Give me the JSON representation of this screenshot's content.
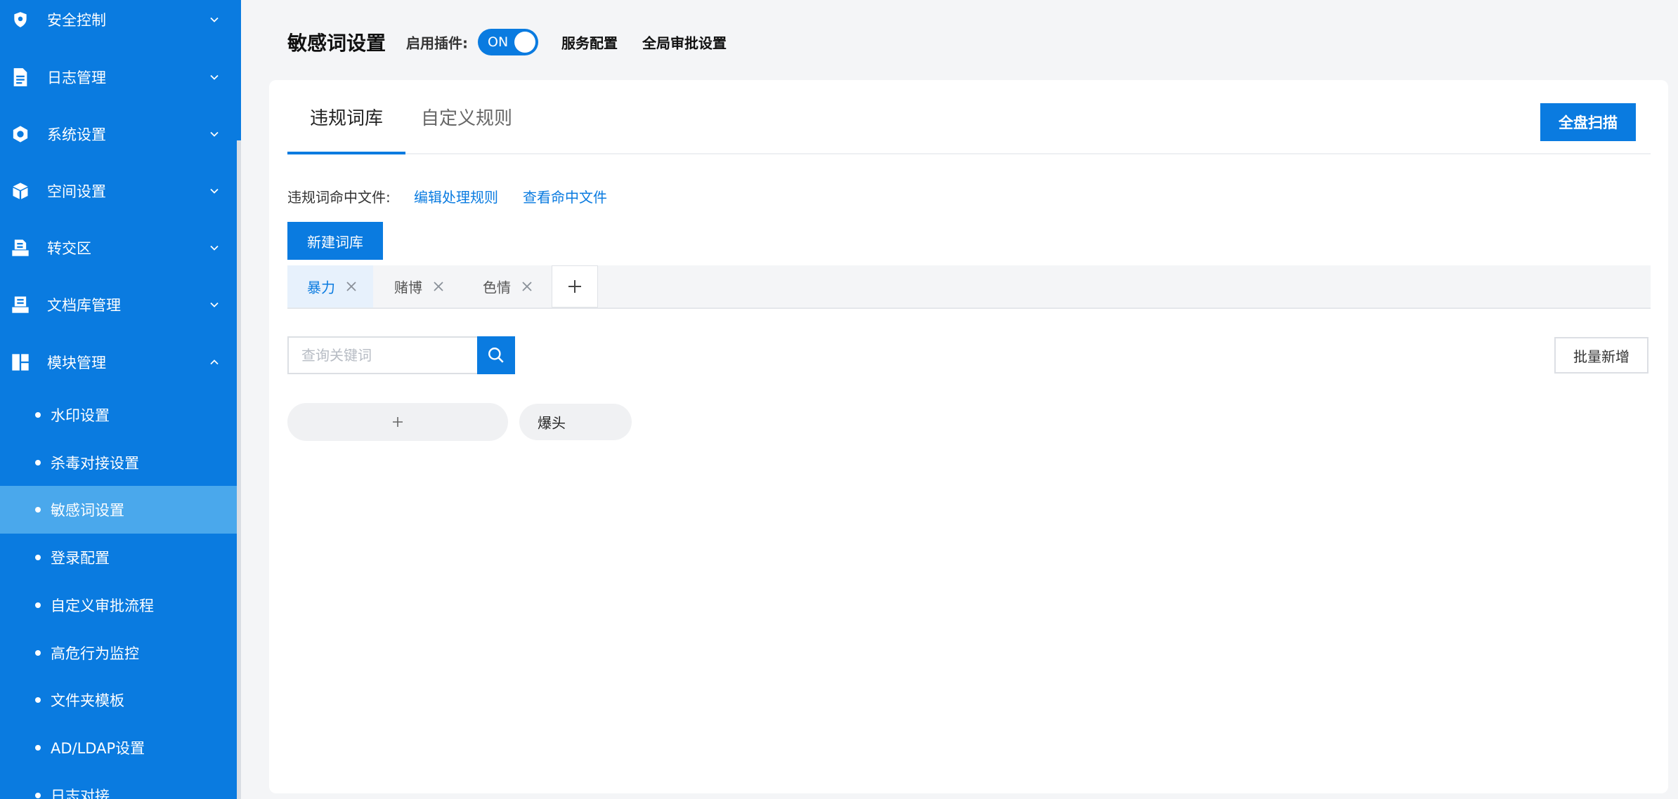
{
  "sidebar": {
    "items": [
      {
        "label": "安全控制",
        "icon": "shield-icon",
        "expanded": false
      },
      {
        "label": "日志管理",
        "icon": "document-icon",
        "expanded": false
      },
      {
        "label": "系统设置",
        "icon": "gear-icon",
        "expanded": false
      },
      {
        "label": "空间设置",
        "icon": "cube-icon",
        "expanded": false
      },
      {
        "label": "转交区",
        "icon": "transfer-icon",
        "expanded": false
      },
      {
        "label": "文档库管理",
        "icon": "library-icon",
        "expanded": false
      },
      {
        "label": "模块管理",
        "icon": "module-icon",
        "expanded": true
      }
    ],
    "subitems": [
      {
        "label": "水印设置"
      },
      {
        "label": "杀毒对接设置"
      },
      {
        "label": "敏感词设置",
        "active": true
      },
      {
        "label": "登录配置"
      },
      {
        "label": "自定义审批流程"
      },
      {
        "label": "高危行为监控"
      },
      {
        "label": "文件夹模板"
      },
      {
        "label": "AD/LDAP设置"
      },
      {
        "label": "日志对接"
      }
    ]
  },
  "header": {
    "title": "敏感词设置",
    "plugin_label": "启用插件:",
    "toggle_text": "ON",
    "toggle_on": true,
    "links": [
      "服务配置",
      "全局审批设置"
    ]
  },
  "tabs": [
    {
      "label": "违规词库",
      "active": true
    },
    {
      "label": "自定义规则",
      "active": false
    }
  ],
  "scan_button": "全盘扫描",
  "hit_files": {
    "label": "违规词命中文件:",
    "edit_rules": "编辑处理规则",
    "view_files": "查看命中文件"
  },
  "new_library_button": "新建词库",
  "libraries": [
    {
      "name": "暴力",
      "active": true
    },
    {
      "name": "赌博",
      "active": false
    },
    {
      "name": "色情",
      "active": false
    }
  ],
  "search": {
    "placeholder": "查询关键词",
    "value": ""
  },
  "batch_add_button": "批量新增",
  "words": [
    "爆头"
  ],
  "colors": {
    "primary": "#0a7be0",
    "sidebar_active": "#4aa8ec",
    "page_bg": "#f4f5f7"
  }
}
